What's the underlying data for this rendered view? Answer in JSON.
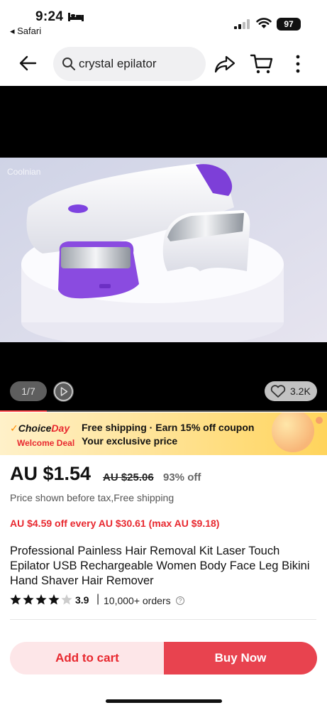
{
  "status_bar": {
    "time": "9:24",
    "back_app": "◂ Safari",
    "battery": "97"
  },
  "nav": {
    "search_text": "crystal epilator"
  },
  "media": {
    "counter": "1/7",
    "likes": "3.2K",
    "watermark": "Coolnian",
    "progress": 0.143
  },
  "promo": {
    "brand_choice": "Choice",
    "brand_day": "Day",
    "welcome": "Welcome Deal",
    "line1": "Free shipping · Earn 15% off coupon",
    "line2": "Your exclusive price"
  },
  "product": {
    "price": "AU $1.54",
    "original_price": "AU $25.06",
    "discount": "93% off",
    "tax_note": "Price shown before tax,Free shipping",
    "coupon": "AU $4.59 off every AU $30.61 (max AU $9.18)",
    "title": "Professional Painless Hair Removal Kit Laser Touch Epilator USB Rechargeable Women Body Face Leg Bikini Hand Shaver Hair Remover",
    "rating": "3.9",
    "rating_stars": 3.9,
    "orders": "10,000+ orders"
  },
  "actions": {
    "add_to_cart": "Add to cart",
    "buy_now": "Buy Now"
  },
  "colors": {
    "accent": "#e8282f",
    "buy_button": "#e8434f",
    "cart_button_bg": "#fde6e8"
  }
}
